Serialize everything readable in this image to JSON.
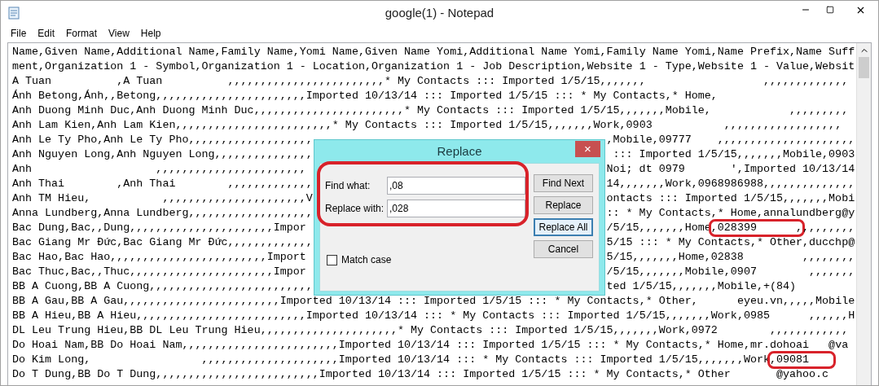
{
  "window": {
    "title": "google(1) - Notepad"
  },
  "menu": [
    {
      "label": "File"
    },
    {
      "label": "Edit"
    },
    {
      "label": "Format"
    },
    {
      "label": "View"
    },
    {
      "label": "Help"
    }
  ],
  "lines": [
    {
      "left": "Name,Given Name,Additional Name,Family Name,Yomi Name,Given Name Yomi,Additional Name Yomi,Family Name Yomi,Name Prefix,Name Suff"
    },
    {
      "left": "ment,Organization 1 - Symbol,Organization 1 - Location,Organization 1 - Job Description,Website 1 - Type,Website 1 - Value,Websit"
    },
    {
      "left": "A Tuan          ,A Tuan          ,,,,,,,,,,,,,,,,,,,,,,,,* My Contacts ::: Imported 1/5/15,,,,,,,                  ,,,,,,,,,,,,,"
    },
    {
      "left": "Ánh Betong,Ánh,,Betong,,,,,,,,,,,,,,,,,,,,,,,Imported 10/13/14 ::: Imported 1/5/15 ::: * My Contacts,* Home,"
    },
    {
      "left": "Anh Duong Minh Duc,Anh Duong Minh Duc,,,,,,,,,,,,,,,,,,,,,,,* My Contacts ::: Imported 1/5/15,,,,,,,Mobile,            ,,,,,,,,,"
    },
    {
      "left": "Anh Lam Kien,Anh Lam Kien,,,,,,,,,,,,,,,,,,,,,,,,* My Contacts ::: Imported 1/5/15,,,,,,,Work,0903           ,,,,,,,,,,,,,,,,,,"
    },
    {
      "left": "Anh Le Ty Pho,Anh Le Ty Pho,,,,,,,,,,,,,,,,,,,",
      "right": ",Mobile,09777    ,,,,,,,,,,,,,,,,,,,,,"
    },
    {
      "left": "Anh Nguyen Long,Anh Nguyen Long,,,,,,,,,,,,,,,",
      "right": " ::: Imported 1/5/15,,,,,,,Mobile,0903"
    },
    {
      "left": "Anh                   ,,,,,,,,,,,,,,,,,,,,,,,",
      "right": "Noi; dt 0979       ',Imported 10/13/14"
    },
    {
      "left": "Anh Thai        ,Anh Thai        ,,,,,,,,,,,,,",
      "right": "14,,,,,,,Work,0968986988,,,,,,,,,,,,,,"
    },
    {
      "left": "Anh TM Hieu,           ,,,,,,,,,,,,,,,,,,,,,,V",
      "right": "ontacts ::: Imported 1/5/15,,,,,,,Mobi"
    },
    {
      "left": "Anna Lundberg,Anna Lundberg,,,,,,,,,,,,,,,,,,,",
      "right": ":: * My Contacts,* Home,annalundberg@y"
    },
    {
      "left": "Bac Dung,Bac,,Dung,,,,,,,,,,,,,,,,,,,,,,Impor",
      "right": "/5/15,,,,,,,Home",
      "marked": ",028399      ,",
      "after": ",,,,,,,,"
    },
    {
      "left": "Bac Giang Mr Đức,Bac Giang Mr Đức,,,,,,,,,,,,,",
      "right": "5/15 ::: * My Contacts,* Other,ducchp@"
    },
    {
      "left": "Bac Hao,Bac Hao,,,,,,,,,,,,,,,,,,,,,,,,Import",
      "right": "5/15,,,,,,,Home,02838         ,,,,,,,,"
    },
    {
      "left": "Bac Thuc,Bac,,Thuc,,,,,,,,,,,,,,,,,,,,,,Impor",
      "right": "/5/15,,,,,,,Mobile,0907        ,,,,,,,"
    },
    {
      "left": "BB A Cuong,BB A Cuong,,,,,,,,,,,,,,,,,,,,,,,,,",
      "right": "ted 1/5/15,,,,,,,Mobile,+(84)"
    },
    {
      "left": "BB A Gau,BB A Gau,,,,,,,,,,,,,,,,,,,,,,,,Imported 10/13/14 ::: Imported 1/5/15 ::: * My Contacts,* Other,      eyeu.vn,,,,,Mobile"
    },
    {
      "left": "BB A Hieu,BB A Hieu,,,,,,,,,,,,,,,,,,,,,,,,,,Imported 10/13/14 ::: * My Contacts ::: Imported 1/5/15,,,,,,,Work,0985      ,,,,,,H"
    },
    {
      "left": "DL Leu Trung Hieu,BB DL Leu Trung Hieu,,,,,,,,,,,,,,,,,,,,,* My Contacts ::: Imported 1/5/15,,,,,,,Work,0972        ,,,,,,,,,,,,"
    },
    {
      "left": "Do Hoai Nam,BB Do Hoai Nam,,,,,,,,,,,,,,,,,,,,,,,,Imported 10/13/14 ::: Imported 1/5/15 ::: * My Contacts,* Home,mr.dohoai   @va"
    },
    {
      "left": "Do Kim Long,                 ,,,,,,,,,,,,,,,,,,,,,Imported 10/13/14 ::: * My Contacts ::: Imported 1/5/15,,,,,,,Work",
      "marked": ",09081"
    },
    {
      "left": "Do T Dung,BB Do T Dung,,,,,,,,,,,,,,,,,,,,,,,,,Imported 10/13/14 ::: Imported 1/5/15 ::: * My Contacts,* Other       @yahoo.c"
    }
  ],
  "dialog": {
    "title": "Replace",
    "close": "×",
    "fields": [
      {
        "label": "Find what:",
        "value": ",08"
      },
      {
        "label": "Replace with:",
        "value": ",028"
      }
    ],
    "match_case": {
      "label": "Match case",
      "checked": false
    },
    "buttons": [
      {
        "label": "Find Next",
        "focused": false
      },
      {
        "label": "Replace",
        "focused": false
      },
      {
        "label": "Replace All",
        "focused": true
      },
      {
        "label": "Cancel",
        "focused": false
      }
    ]
  }
}
